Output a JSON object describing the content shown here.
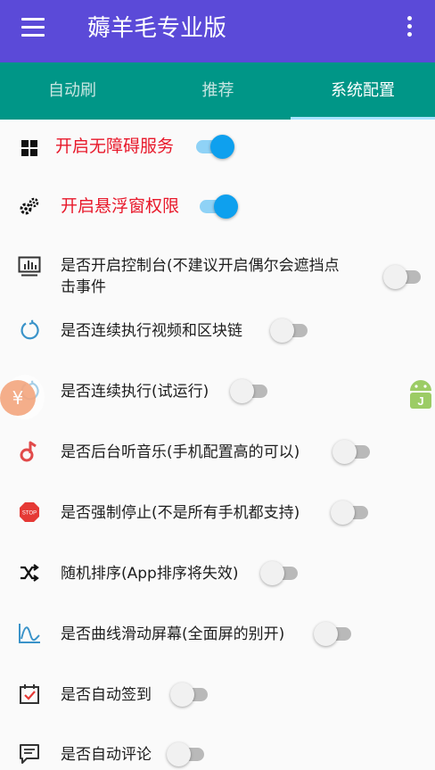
{
  "app": {
    "title": "薅羊毛专业版",
    "bar_color": "#5b4ad8",
    "tab_color": "#009687"
  },
  "tabs": [
    {
      "label": "自动刷",
      "active": false
    },
    {
      "label": "推荐",
      "active": false
    },
    {
      "label": "系统配置",
      "active": true
    }
  ],
  "settings": [
    {
      "icon": "grid-icon",
      "label": "开启无障碍服务",
      "on": true
    },
    {
      "icon": "gears-icon",
      "label": "开启悬浮窗权限",
      "on": true
    },
    {
      "icon": "monitor-chart-icon",
      "label_line1": "是否开启控制台(不建议开启偶尔会遮挡点",
      "label_line2": "击事件",
      "on": false
    },
    {
      "icon": "refresh-icon",
      "label": "是否连续执行视频和区块链",
      "on": false
    },
    {
      "icon": "refresh-icon",
      "label": "是否连续执行(试运行)",
      "on": false
    },
    {
      "icon": "music-note-icon",
      "label": "是否后台听音乐(手机配置高的可以)",
      "on": false
    },
    {
      "icon": "stop-sign-icon",
      "label": "是否强制停止(不是所有手机都支持)",
      "on": false
    },
    {
      "icon": "shuffle-icon",
      "label": "随机排序(App排序将失效)",
      "on": false
    },
    {
      "icon": "curve-chart-icon",
      "label": "是否曲线滑动屏幕(全面屏的别开)",
      "on": false
    },
    {
      "icon": "calendar-check-icon",
      "label": "是否自动签到",
      "on": false
    },
    {
      "icon": "comment-icon",
      "label": "是否自动评论",
      "on": false
    }
  ],
  "floating": {
    "coin_symbol": "¥",
    "stop_sign_text": "STOP"
  }
}
